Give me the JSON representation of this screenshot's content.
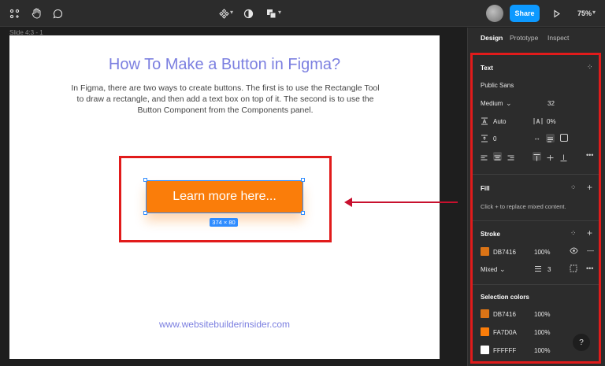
{
  "toolbar": {
    "share_label": "Share",
    "zoom_label": "75%",
    "icons": [
      "components-icon",
      "hand-icon",
      "comment-icon",
      "component-tool-icon",
      "contrast-icon",
      "boolean-icon",
      "play-icon"
    ]
  },
  "canvas": {
    "slide_label": "Slide 4:3 - 1",
    "title": "How To Make a Button in Figma?",
    "body": "In Figma, there are two ways to create buttons. The first is to use the Rectangle Tool to draw a rectangle, and then add a text box on top of it. The second is to use the Button Component from the Components panel.",
    "button_label": "Learn more here...",
    "dimensions": "374 × 80",
    "url": "www.websitebuilderinsider.com"
  },
  "panel": {
    "tabs": [
      "Design",
      "Prototype",
      "Inspect"
    ],
    "text": {
      "title": "Text",
      "font_family": "Public Sans",
      "font_weight": "Medium",
      "font_size": "32",
      "line_height": "Auto",
      "letter_spacing": "0%",
      "paragraph_spacing": "0"
    },
    "fill": {
      "title": "Fill",
      "hint": "Click + to replace mixed content."
    },
    "stroke": {
      "title": "Stroke",
      "color": "DB7416",
      "opacity": "100%",
      "position": "Mixed",
      "weight": "3"
    },
    "selection_colors": {
      "title": "Selection colors",
      "items": [
        {
          "hex": "DB7416",
          "opacity": "100%",
          "swatch": "#db7416"
        },
        {
          "hex": "FA7D0A",
          "opacity": "100%",
          "swatch": "#fa7d0a"
        },
        {
          "hex": "FFFFFF",
          "opacity": "100%",
          "swatch": "#ffffff"
        }
      ]
    },
    "help_label": "?"
  }
}
